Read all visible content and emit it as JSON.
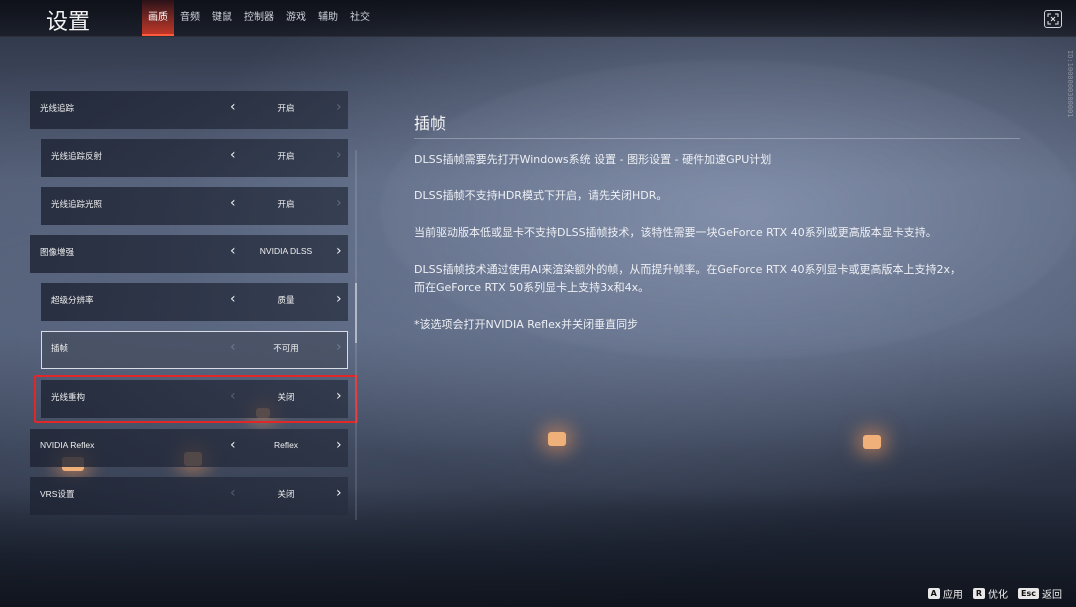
{
  "header": {
    "title": "设置",
    "tabs": [
      {
        "label": "画质",
        "active": true
      },
      {
        "label": "音频",
        "active": false
      },
      {
        "label": "键鼠",
        "active": false
      },
      {
        "label": "控制器",
        "active": false
      },
      {
        "label": "游戏",
        "active": false
      },
      {
        "label": "辅助",
        "active": false
      },
      {
        "label": "社交",
        "active": false
      }
    ],
    "close_icon": "close-icon"
  },
  "settings": [
    {
      "label": "光线追踪",
      "value": "开启",
      "indent": false
    },
    {
      "label": "光线追踪反射",
      "value": "开启",
      "indent": true
    },
    {
      "label": "光线追踪光照",
      "value": "开启",
      "indent": true
    },
    {
      "label": "图像增强",
      "value": "NVIDIA DLSS",
      "indent": false
    },
    {
      "label": "超级分辨率",
      "value": "质量",
      "indent": true
    },
    {
      "label": "插帧",
      "value": "不可用",
      "indent": true,
      "selected": true
    },
    {
      "label": "光线重构",
      "value": "关闭",
      "indent": true,
      "highlighted": true
    },
    {
      "label": "NVIDIA Reflex",
      "value": "Reflex",
      "indent": false
    },
    {
      "label": "VRS设置",
      "value": "关闭",
      "indent": false
    }
  ],
  "description": {
    "title": "插帧",
    "paragraphs": [
      "DLSS插帧需要先打开Windows系统 设置 - 图形设置 - 硬件加速GPU计划",
      "DLSS插帧不支持HDR模式下开启，请先关闭HDR。",
      "当前驱动版本低或显卡不支持DLSS插帧技术，该特性需要一块GeForce RTX 40系列或更高版本显卡支持。",
      "DLSS插帧技术通过使用AI来渲染额外的帧，从而提升帧率。在GeForce RTX 40系列显卡或更高版本上支持2x，",
      "而在GeForce RTX 50系列显卡上支持3x和4x。",
      "*该选项会打开NVIDIA Reflex并关闭垂直同步"
    ]
  },
  "id_text": "ID:1000000300001",
  "footer": {
    "hints": [
      {
        "key": "A",
        "label": "应用"
      },
      {
        "key": "R",
        "label": "优化"
      },
      {
        "key": "Esc",
        "label": "返回"
      }
    ]
  },
  "colors": {
    "accent": "#e63c28",
    "highlight_box": "#e02828"
  }
}
